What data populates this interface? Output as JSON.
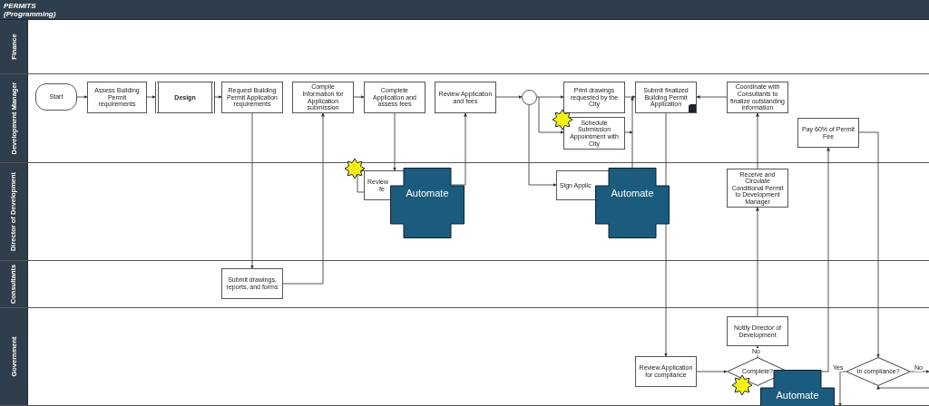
{
  "header": {
    "title": "PERMITS",
    "subtitle": "(Programming)"
  },
  "lanes": [
    {
      "name": "Finance"
    },
    {
      "name": "Development Manager"
    },
    {
      "name": "Director of Development"
    },
    {
      "name": "Consultants"
    },
    {
      "name": "Government"
    }
  ],
  "nodes": [
    {
      "kind": "terminator",
      "label": "Start"
    },
    {
      "kind": "process",
      "label": "Assess Building Permit requirements"
    },
    {
      "kind": "subprocess",
      "label": "Design"
    },
    {
      "kind": "process",
      "label": "Request Building Permit Application requirements"
    },
    {
      "kind": "process",
      "label": "Compile Information for Application submission"
    },
    {
      "kind": "process",
      "label": "Complete Application and assess fees"
    },
    {
      "kind": "process",
      "label": "Review Application and fees"
    },
    {
      "kind": "junction"
    },
    {
      "kind": "process",
      "label": "Print drawings requested by the City"
    },
    {
      "kind": "document",
      "label": "Submit finalized Building Permit Application"
    },
    {
      "kind": "process",
      "label": "Coordinate with Consultants to finalize outstanding information"
    },
    {
      "kind": "process",
      "label": "Schedule Submission Appointment with City"
    },
    {
      "kind": "process",
      "label": "Pay 60% of Permit Fee"
    },
    {
      "kind": "partial",
      "label": "Review",
      "label_2": "fe"
    },
    {
      "kind": "partial",
      "label": "Sign Applic"
    },
    {
      "kind": "process",
      "label": "Receive and Circulate Conditional Permit to Development Manager"
    },
    {
      "kind": "process",
      "label": "Submit drawings, reports, and forms"
    },
    {
      "kind": "process",
      "label": "Notify Director of Development"
    },
    {
      "kind": "process",
      "label": "Review Application for compliance"
    },
    {
      "kind": "decision",
      "label": "Complete?"
    },
    {
      "kind": "decision",
      "label": "In compliance?"
    }
  ],
  "edge_labels": [
    "No",
    "Yes",
    "No"
  ],
  "callouts": [
    {
      "kind": "automate",
      "label": "Automate"
    },
    {
      "kind": "automate",
      "label": "Automate"
    },
    {
      "kind": "automate",
      "label": "Automate"
    }
  ]
}
